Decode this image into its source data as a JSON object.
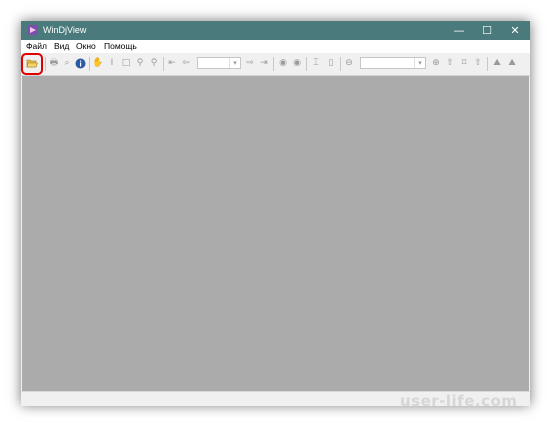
{
  "window": {
    "title": "WinDjView"
  },
  "title_buttons": [
    {
      "name": "minimize-button",
      "glyph": "—"
    },
    {
      "name": "maximize-button",
      "glyph": "☐"
    },
    {
      "name": "close-button",
      "glyph": "✕"
    }
  ],
  "menu": [
    "Файл",
    "Вид",
    "Окно",
    "Помощь"
  ],
  "toolbar": {
    "open_icon": "folder-open-icon",
    "highlight_color": "#e00000",
    "page_combo_value": "",
    "zoom_combo_value": ""
  },
  "colors": {
    "titlebar": "#4a7a7b",
    "content_background": "#ababab"
  },
  "watermark": "user-life.com"
}
